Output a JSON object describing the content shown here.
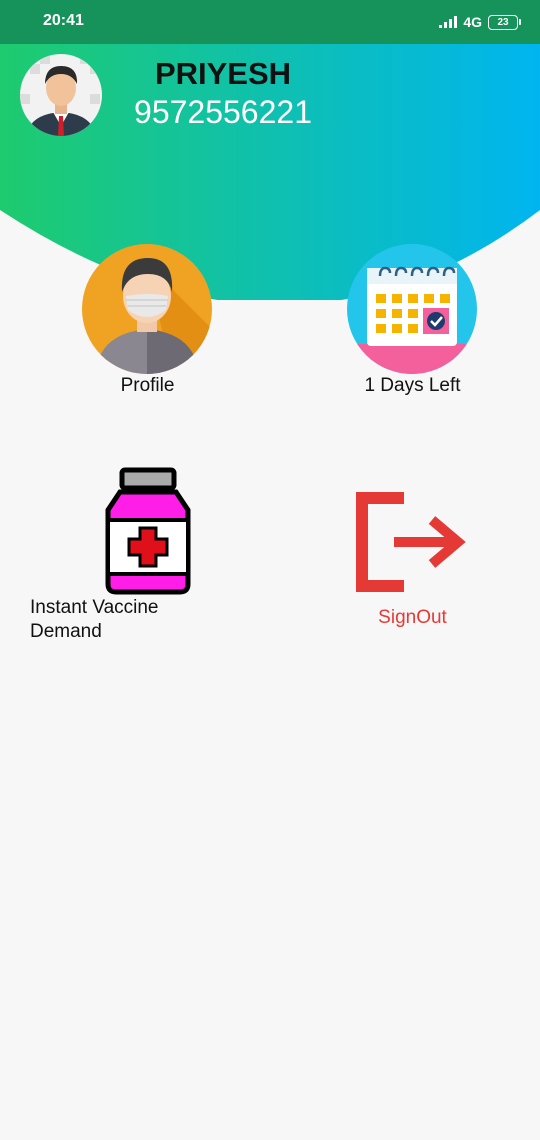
{
  "status": {
    "time": "20:41",
    "network": "4G",
    "battery": "23"
  },
  "header": {
    "name": "PRIYESH",
    "phone": "9572556221",
    "avatar_icon": "user-avatar-icon"
  },
  "menu": {
    "profile": {
      "label": "Profile",
      "icon": "masked-person-icon"
    },
    "days_left": {
      "label": "1 Days Left",
      "icon": "calendar-icon"
    },
    "vaccine": {
      "label": "Instant Vaccine Demand",
      "icon": "medicine-bottle-icon"
    },
    "signout": {
      "label": "SignOut",
      "icon": "exit-icon"
    }
  },
  "colors": {
    "header_gradient_start": "#1ecb6e",
    "header_gradient_end": "#00b5f0",
    "status_bar": "#15935b",
    "signout": "#e53935",
    "bottle": "#ff1ee8"
  }
}
